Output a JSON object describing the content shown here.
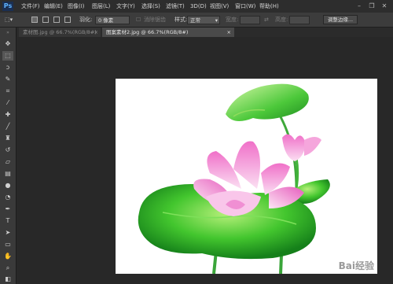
{
  "app": {
    "logo": "Ps"
  },
  "menus": [
    "文件(F)",
    "编辑(E)",
    "图像(I)",
    "图层(L)",
    "文字(Y)",
    "选择(S)",
    "滤镜(T)",
    "3D(D)",
    "视图(V)",
    "窗口(W)",
    "帮助(H)"
  ],
  "options": {
    "feather_label": "羽化:",
    "feather_value": "0 像素",
    "antialias_label": "消除锯齿",
    "style_label": "样式:",
    "style_value": "正常",
    "width_label": "宽度:",
    "height_label": "高度:",
    "refine_edge_label": "调整边缘..."
  },
  "tabs": [
    {
      "label": "素材图.jpg @ 66.7%(RGB/8#)",
      "close": "×"
    },
    {
      "label": "图案素材2.jpg @ 66.7%(RGB/8#)",
      "close": "×"
    }
  ],
  "window_controls": {
    "minimize": "–",
    "restore": "❐",
    "close": "✕"
  },
  "watermark": "Bai经验"
}
